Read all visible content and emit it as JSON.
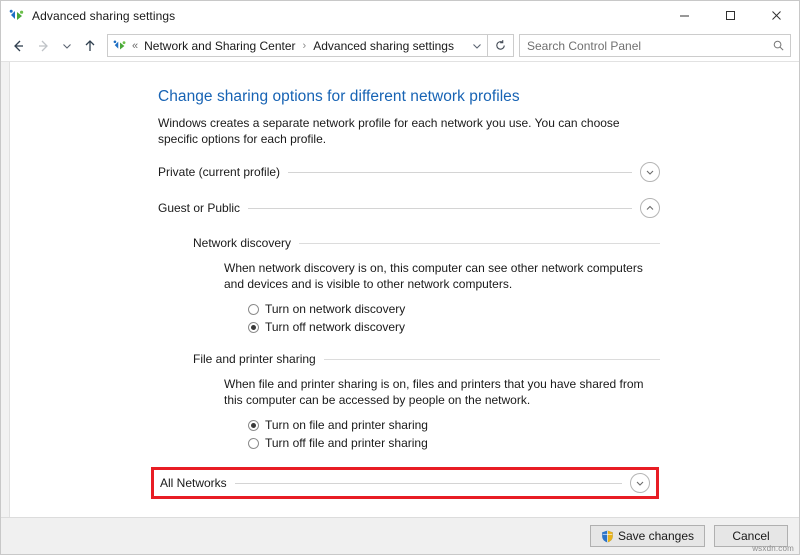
{
  "window": {
    "title": "Advanced sharing settings",
    "title_icon": "network-sharing-icon",
    "minimize_label": "Minimize",
    "maximize_label": "Maximize",
    "close_label": "Close"
  },
  "navbar": {
    "back_label": "Back",
    "forward_label": "Forward",
    "recent_label": "Recent locations",
    "up_label": "Up one level",
    "address_icon": "network-sharing-icon",
    "address_lead": "«",
    "breadcrumbs": [
      {
        "label": "Network and Sharing Center"
      },
      {
        "label": "Advanced sharing settings"
      }
    ],
    "breadcrumb_separator": "›",
    "address_dropdown_label": "Previous locations",
    "refresh_label": "Refresh",
    "search": {
      "placeholder": "Search Control Panel",
      "value": "",
      "icon": "search-icon"
    }
  },
  "main": {
    "page_title": "Change sharing options for different network profiles",
    "intro": "Windows creates a separate network profile for each network you use. You can choose specific options for each profile.",
    "profiles": [
      {
        "label": "Private (current profile)",
        "expanded": false,
        "toggle_icon": "chevron-down-icon"
      },
      {
        "label": "Guest or Public",
        "expanded": true,
        "toggle_icon": "chevron-up-icon"
      }
    ],
    "sections": [
      {
        "heading": "Network discovery",
        "description": "When network discovery is on, this computer can see other network computers and devices and is visible to other network computers.",
        "options": [
          {
            "label": "Turn on network discovery",
            "checked": false
          },
          {
            "label": "Turn off network discovery",
            "checked": true
          }
        ]
      },
      {
        "heading": "File and printer sharing",
        "description": "When file and printer sharing is on, files and printers that you have shared from this computer can be accessed by people on the network.",
        "options": [
          {
            "label": "Turn on file and printer sharing",
            "checked": true
          },
          {
            "label": "Turn off file and printer sharing",
            "checked": false
          }
        ]
      }
    ],
    "all_networks": {
      "label": "All Networks",
      "expanded": false,
      "toggle_icon": "chevron-down-icon",
      "highlight_color": "#e81d24",
      "highlighted": true
    }
  },
  "footer": {
    "save_label": "Save changes",
    "save_icon": "uac-shield-icon",
    "cancel_label": "Cancel",
    "watermark": "wsxdn.com"
  },
  "colors": {
    "title_link": "#1763b4",
    "highlight": "#e81d24",
    "footer_bg": "#f0f0f0",
    "rule": "#d4d4d4"
  }
}
